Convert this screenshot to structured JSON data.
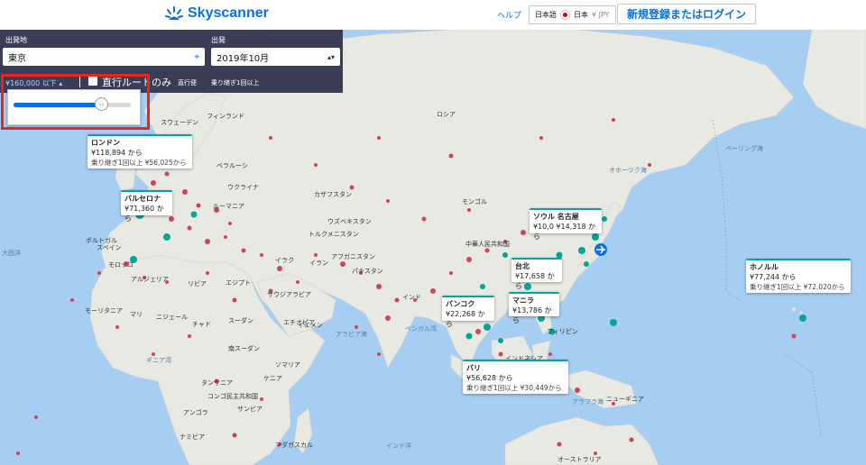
{
  "header": {
    "brand": "Skyscanner",
    "help": "ヘルプ",
    "language": "日本語",
    "country": "日本",
    "currency": "¥ JPY",
    "login": "新規登録またはログイン"
  },
  "search": {
    "origin_label": "出発地",
    "origin_value": "東京",
    "depart_label": "出発",
    "depart_value": "2019年10月",
    "price_filter": "¥160,000 以下",
    "direct_only": "直行ルートのみ",
    "direct": "直行便",
    "one_stop": "乗り継ぎ1回以上",
    "slider_level": 0.75
  },
  "map": {
    "countries": [
      "フィンランド",
      "ロシア",
      "スウェーデン",
      "ベラルーシ",
      "ウクライナ",
      "カザフスタン",
      "モンゴル",
      "ルーマニア",
      "ウズベキスタン",
      "トルクメニスタン",
      "アフガニスタン",
      "パキスタン",
      "中華人民共和国",
      "イラン",
      "イラク",
      "サウジアラビア",
      "インド",
      "スペイン",
      "ポルトガル",
      "モロッコ",
      "アルジェリア",
      "リビア",
      "エジプト",
      "マリ",
      "ニジェール",
      "チャド",
      "スーダン",
      "モーリタニア",
      "エチオピア",
      "南スーダン",
      "ソマリア",
      "ケニア",
      "タンザニア",
      "コンゴ民主共和国",
      "アンゴラ",
      "ザンビア",
      "ナミビア",
      "マダガスカル",
      "イエメン",
      "オーストラリア",
      "インドネシア",
      "ニューギニア",
      "フィリピン"
    ],
    "seas": [
      "大西洋",
      "インド洋",
      "ベーリング海",
      "オホーツク海",
      "アラビア海",
      "ベンガル湾",
      "アラフラ海",
      "ギニア湾"
    ]
  },
  "popups": [
    {
      "city": "ロンドン",
      "price": "¥118,894 から",
      "sub": "乗り継ぎ1回以上 ¥56,025から"
    },
    {
      "city": "バルセロナ",
      "price": "¥71,360 から"
    },
    {
      "city": "ソウル 名古屋",
      "price": "¥10,0 ¥14,318 から"
    },
    {
      "city": "台北",
      "price": "¥17,658 から"
    },
    {
      "city": "マニラ",
      "price": "¥13,786 から"
    },
    {
      "city": "バンコク",
      "price": "¥22,268 から"
    },
    {
      "city": "バリ",
      "price": "¥56,628 から",
      "sub": "乗り継ぎ1回以上 ¥30,449から"
    },
    {
      "city": "ホノルル",
      "price": "¥77,244 から",
      "sub": "乗り継ぎ1回以上 ¥72,020から"
    }
  ],
  "colors": {
    "brand": "#0770e3",
    "panel": "#3b3d57",
    "direct_pin": "#00a698",
    "stop_pin": "#d1435b",
    "highlight": "#e8261b"
  }
}
